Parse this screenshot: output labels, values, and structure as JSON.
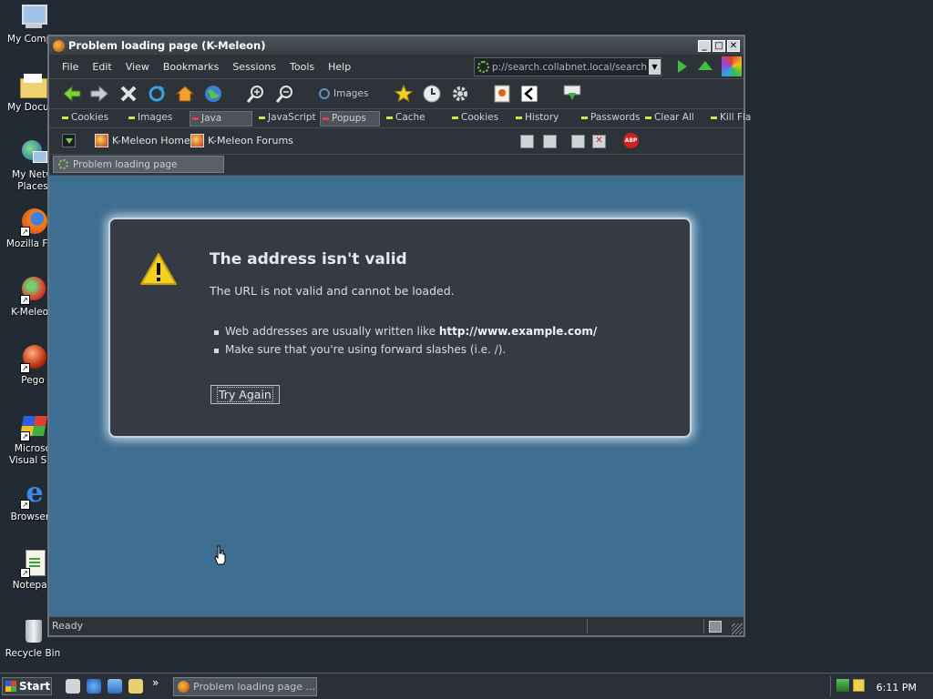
{
  "desktop": {
    "icons": [
      {
        "label": "My Compu",
        "name": "my-computer"
      },
      {
        "label": "My Docum",
        "name": "my-documents"
      },
      {
        "label": "My Netw\nPlaces",
        "name": "my-network-places"
      },
      {
        "label": "Mozilla Fire",
        "name": "mozilla-firefox"
      },
      {
        "label": "K-Meleon",
        "name": "k-meleon"
      },
      {
        "label": "Pego",
        "name": "pego"
      },
      {
        "label": "Microso\nVisual Stu",
        "name": "microsoft-visual-studio"
      },
      {
        "label": "Browserv",
        "name": "browserv"
      },
      {
        "label": "Notepad",
        "name": "notepad"
      },
      {
        "label": "Recycle Bin",
        "name": "recycle-bin"
      }
    ]
  },
  "window": {
    "title": "Problem loading page (K-Meleon)",
    "menus": [
      "File",
      "Edit",
      "View",
      "Bookmarks",
      "Sessions",
      "Tools",
      "Help"
    ],
    "url": "p://search.collabnet.local/search",
    "toolbar_images_label": "Images",
    "quick_toggles": [
      "Cookies",
      "Images",
      "Java",
      "JavaScript",
      "Popups",
      "Cache",
      "Cookies",
      "History",
      "Passwords",
      "Clear All",
      "Kill Fla"
    ],
    "bookmarks": [
      "K-Meleon Home",
      "K-Meleon Forums"
    ],
    "tab_label": "Problem loading page",
    "status_text": "Ready"
  },
  "error": {
    "title": "The address isn't valid",
    "description": "The URL is not valid and cannot be loaded.",
    "bullet1_prefix": "Web addresses are usually written like ",
    "bullet1_bold": "http://www.example.com/",
    "bullet2": "Make sure that you're using forward slashes (i.e. /).",
    "try_again": "Try Again"
  },
  "taskbar": {
    "start_label": "Start",
    "task_label": "Problem loading page ...",
    "clock": "6:11 PM",
    "overflow": "»"
  },
  "colors": {
    "content_bg": "#3f6e93",
    "chrome_bg": "#2e333a",
    "error_panel": "#363b43",
    "accent_green": "#7fd040"
  }
}
